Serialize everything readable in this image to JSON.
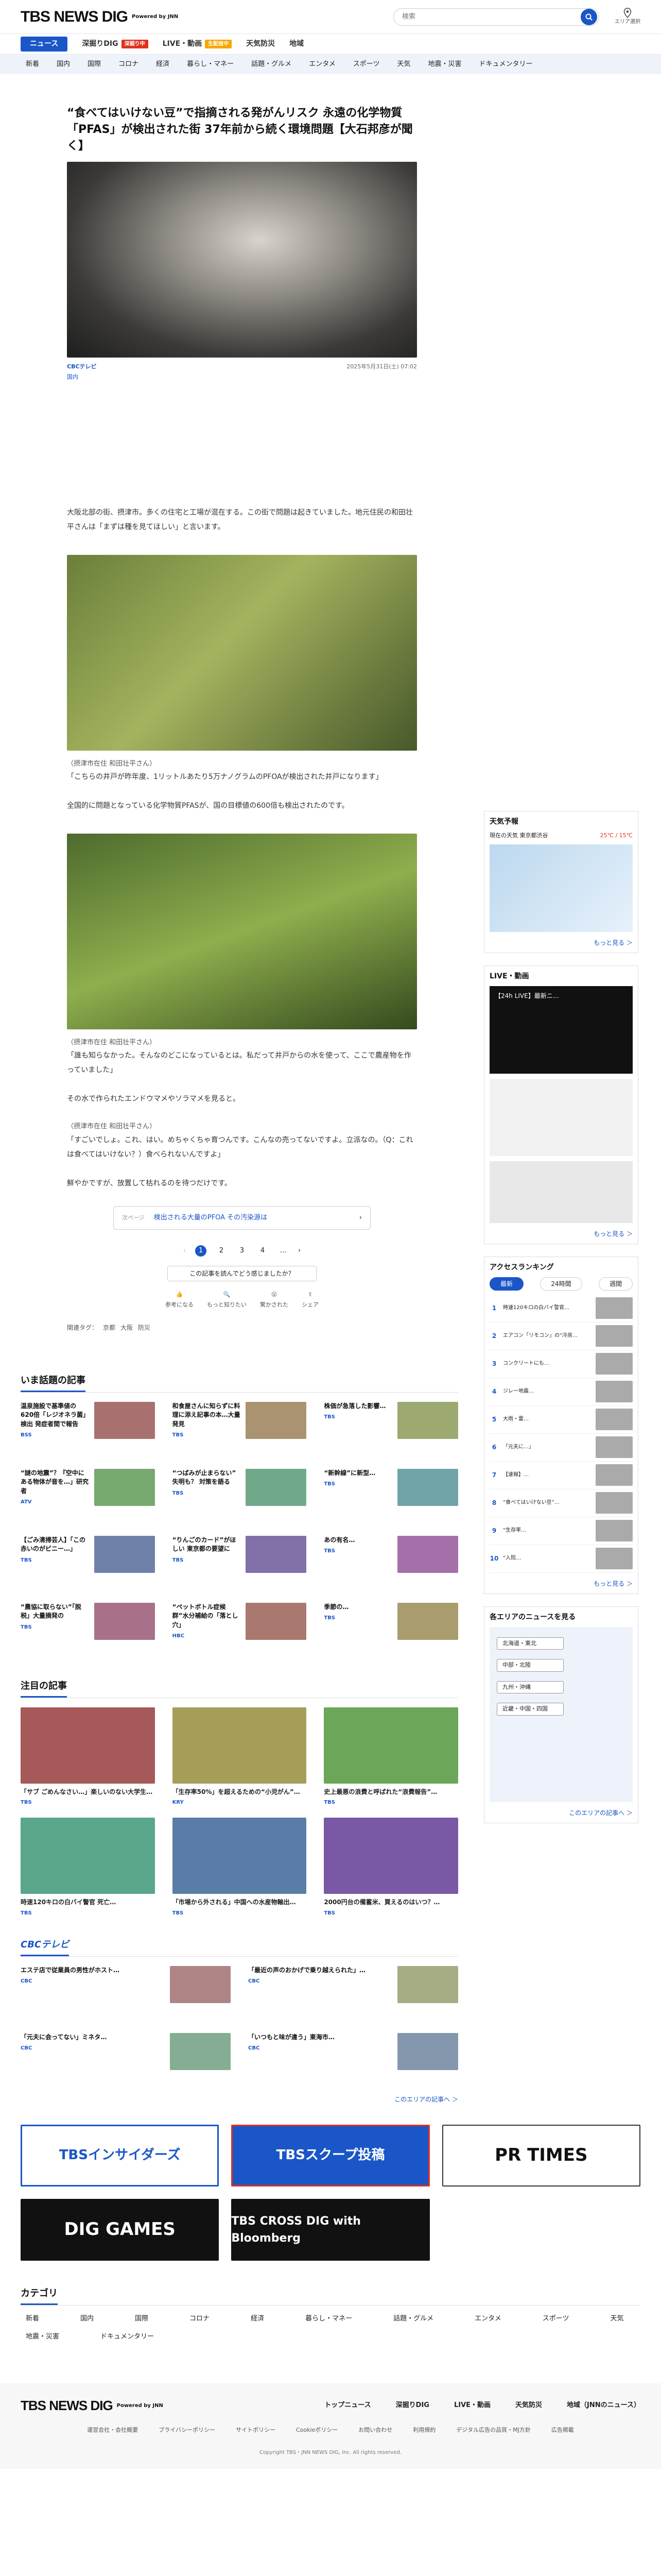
{
  "header": {
    "logo_text": "TBS NEWS DIG",
    "powered": "Powered by JNN",
    "search_placeholder": "検索",
    "area_label": "エリア選択"
  },
  "tabs": [
    {
      "label": "ニュース",
      "active": true
    },
    {
      "label": "深掘りDIG",
      "badge": "深掘り中"
    },
    {
      "label": "LIVE・動画",
      "badge": "生配信中"
    },
    {
      "label": "天気防災"
    },
    {
      "label": "地域"
    }
  ],
  "categories": [
    "新着",
    "国内",
    "国際",
    "コロナ",
    "経済",
    "暮らし・マネー",
    "話題・グルメ",
    "エンタメ",
    "スポーツ",
    "天気",
    "地震・災害",
    "ドキュメンタリー"
  ],
  "article": {
    "title": "“食べてはいけない豆”で指摘される発がんリスク 永遠の化学物質「PFAS」が検出された街 37年前から続く環境問題【大石邦彦が聞く】",
    "publisher": "CBCテレビ",
    "date": "2025年5月31日(土) 07:02",
    "genre": "国内",
    "intro": "大阪北部の街、摂津市。多くの住宅と工場が混在する。この街で問題は起きていました。地元住民の和田壮平さんは「まずは種を見てほしい」と言います。",
    "cap1": "（摂津市在住 和田壮平さん）",
    "quote1": "「こちらの井戸が昨年度、1リットルあたり5万ナノグラムのPFOAが検出された井戸になります」",
    "body2": "全国的に問題となっている化学物質PFASが、国の目標値の600倍も検出されたのです。",
    "cap2": "（摂津市在住 和田壮平さん）",
    "quote2": "「誰も知らなかった。そんなのどこになっているとは。私だって井戸からの水を使って、ここで農産物を作っていました」",
    "body3": "その水で作られたエンドウマメやソラマメを見ると。",
    "cap3": "（摂津市在住 和田壮平さん）",
    "quote3": "「すごいでしょ。これ、はい。めちゃくちゃ育つんです。こんなの売ってないですよ。立派なの。（Q：これは食べてはいけない？）食べられないんですよ」",
    "body4": "鮮やかですが、放置して枯れるのを待つだけです。",
    "related_label": "次ページ",
    "related_text": "検出される大量のPFOA その汚染源は",
    "pages": [
      "1",
      "2",
      "3",
      "4",
      "…"
    ],
    "help_text": "この記事を読んでどう感じましたか？",
    "reactions": [
      "参考になる",
      "もっと知りたい",
      "驚かされた",
      "シェア"
    ],
    "tags_label": "関連タグ：",
    "tags": [
      "京都",
      "大阪",
      "防災"
    ]
  },
  "sections": {
    "popular": "いま話題の記事",
    "featured": "注目の記事",
    "cbc": "CBCテレビ",
    "categories": "カテゴリ",
    "more": "もっと見る ＞",
    "more_area": "このエリアの記事へ ＞"
  },
  "popular": [
    {
      "title": "温泉施設で基準値の620倍「レジオネラ菌」検出 発症者間で報告",
      "src": "BSS"
    },
    {
      "title": "和食屋さんに知らずに料理に添え記事の本…大量発見",
      "src": "TBS"
    },
    {
      "title": "株価が急落した影響…",
      "src": "TBS"
    },
    {
      "title": "“謎の地震”？『空中にある物体が音を…」研究者",
      "src": "ATV"
    },
    {
      "title": "“つばみが止まらない” 失明も？ 対策を語る",
      "src": "TBS"
    },
    {
      "title": "“新幹線”に新型…",
      "src": "TBS"
    },
    {
      "title": "【ごみ清掃芸人】「この赤いのがビニー…」",
      "src": "TBS"
    },
    {
      "title": "“りんごのカード”がほしい 東京都の要望に",
      "src": "TBS"
    },
    {
      "title": "あの有名…",
      "src": "TBS"
    },
    {
      "title": "“農協に取らない”「脱税」大量摘発の",
      "src": "TBS"
    },
    {
      "title": "“ペットボトル症候群”水分補給の「落とし穴」",
      "src": "HBC"
    },
    {
      "title": "季節の…",
      "src": "TBS"
    }
  ],
  "featured": [
    {
      "title": "「サブ ごめんなさい…」楽しいのない大学生…",
      "src": "TBS"
    },
    {
      "title": "「生存率50%」を超えるための“小児がん”…",
      "src": "KRY"
    },
    {
      "title": "史上最悪の浪費と呼ばれた“浪費報告”…",
      "src": "TBS"
    },
    {
      "title": "時速120キロの白バイ警官 死亡…",
      "src": "TBS"
    },
    {
      "title": "「市場から外される」中国への水産物輸出…",
      "src": "TBS"
    },
    {
      "title": "2000円台の備蓄米、買えるのはいつ？…",
      "src": "TBS"
    }
  ],
  "cbc_items": [
    {
      "title": "エステ店で従業員の男性がホスト…",
      "src": "CBC"
    },
    {
      "title": "「最近の声のおかげで乗り越えられた」…",
      "src": "CBC"
    },
    {
      "title": "「元夫に会ってない」ミネタ…",
      "src": "CBC"
    },
    {
      "title": "「いつもと味が違う」東海市…",
      "src": "CBC"
    }
  ],
  "banners": [
    {
      "label": "TBSインサイダーズ"
    },
    {
      "label": "TBSスクープ投稿"
    },
    {
      "label": "PR TIMES"
    },
    {
      "label": "DIG GAMES"
    },
    {
      "label": "TBS CROSS DIG with Bloomberg"
    }
  ],
  "foot_categories": [
    "新着",
    "国内",
    "国際",
    "コロナ",
    "経済",
    "暮らし・マネー",
    "話題・グルメ",
    "エンタメ",
    "スポーツ",
    "天気",
    "地震・災害",
    "ドキュメンタリー"
  ],
  "footer": {
    "links": [
      "トップニュース",
      "深掘りDIG",
      "LIVE・動画",
      "天気防災",
      "地域（JNNのニュース）"
    ],
    "sub": [
      "運営会社・会社概要",
      "プライバシーポリシー",
      "サイトポリシー",
      "Cookieポリシー",
      "お問い合わせ",
      "利用規約",
      "デジタル広告の品質・MJ方針",
      "広告掲載"
    ],
    "copy": "Copyright TBS・JNN NEWS DIG, Inc. All rights reserved."
  },
  "sidebar": {
    "weather_title": "天気予報",
    "weather_loc": "現在の天気 東京都渋谷",
    "weather_temp": "25℃ / 15℃",
    "live_title": "LIVE・動画",
    "live_video": "【24h LIVE】最新ニ…",
    "ranking_title": "アクセスランキング",
    "ranking_tabs": [
      "最新",
      "24時間",
      "週間"
    ],
    "ranking": [
      "時速120キロの白バイ警官…",
      "エアコン「リモコン」の“冷房…",
      "コンクリートにも…",
      "ジレー地震…",
      "大雨・雷…",
      "「元夫に…」",
      "【速報】…",
      "“食べてはいけない豆”…",
      "“生存率…",
      "“入院…"
    ],
    "area_title": "各エリアのニュースを見る",
    "areas": [
      "北海道・東北",
      "中部・北陸",
      "九州・沖縄",
      "近畿・中国・四国"
    ]
  }
}
